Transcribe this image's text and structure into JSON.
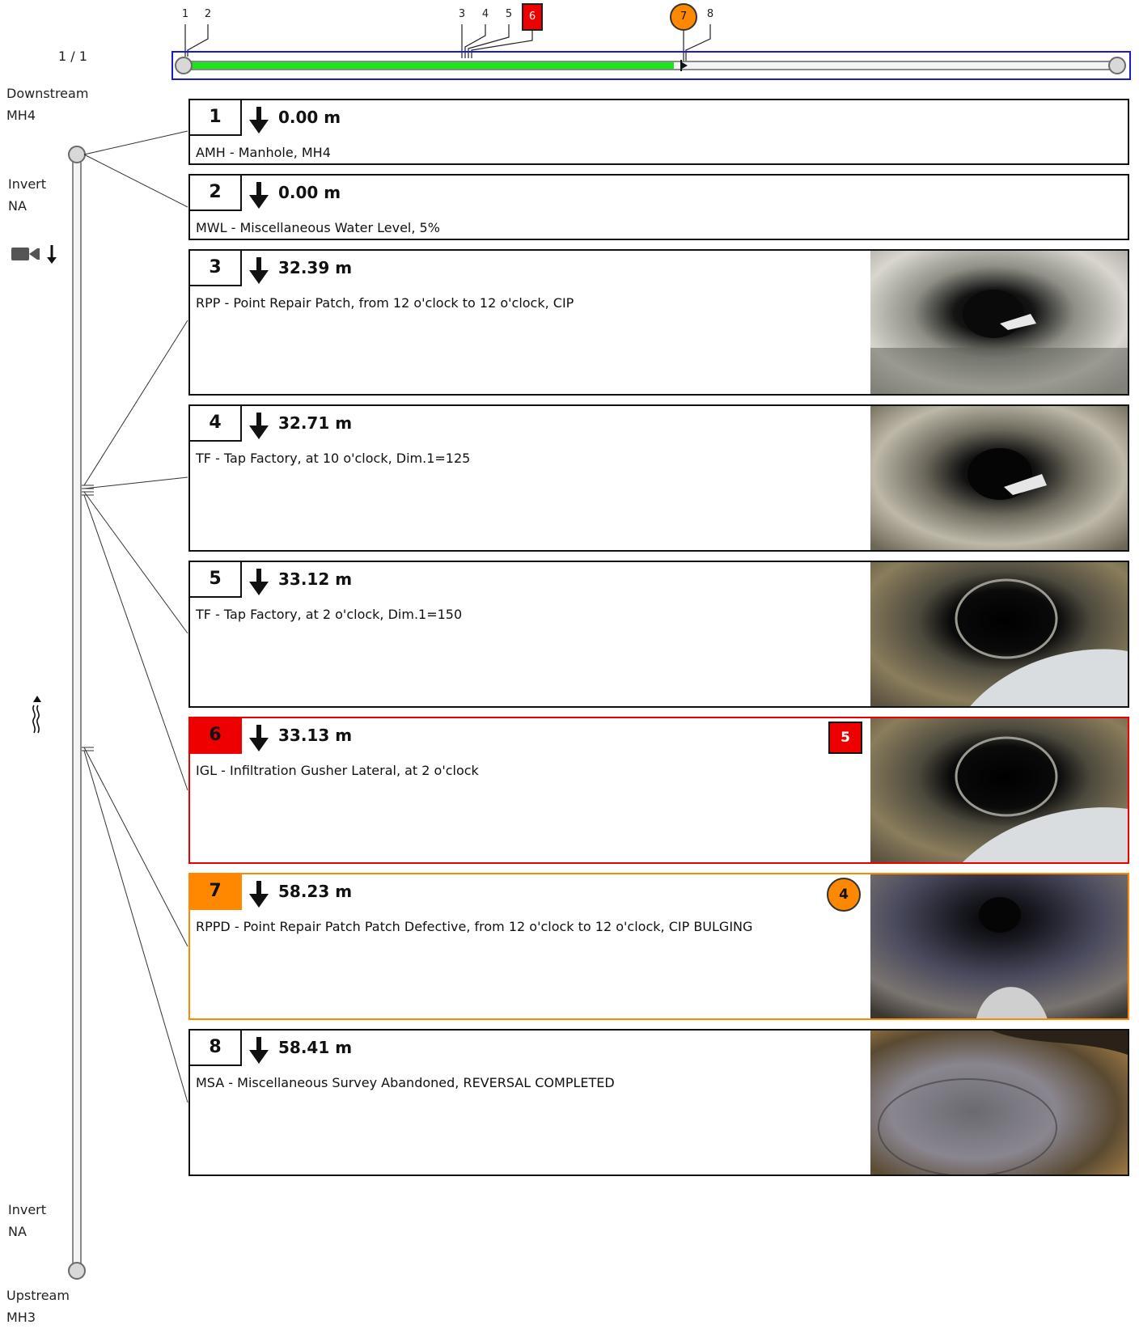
{
  "page_counter": "1 / 1",
  "downstream": {
    "title": "Downstream",
    "manhole": "MH4"
  },
  "invert_top": {
    "label": "Invert",
    "value": "NA"
  },
  "upstream": {
    "title": "Upstream",
    "manhole": "MH3"
  },
  "invert_bottom": {
    "label": "Invert",
    "value": "NA"
  },
  "icons": {
    "camera": "camera-icon",
    "direction": "down-arrow-icon",
    "flow": "flow-icon"
  },
  "colors": {
    "progress": "#19e619",
    "frame": "#1a1acc",
    "grade_red": "#ee0000",
    "grade_orange": "#ff8800"
  },
  "overview": {
    "progress_fraction": 0.5,
    "ticks": [
      "1",
      "2",
      "3",
      "4",
      "5",
      "6",
      "7",
      "8"
    ]
  },
  "events": [
    {
      "num": "1",
      "distance": "0.00 m",
      "description": "AMH - Manhole, MH4",
      "grade": ""
    },
    {
      "num": "2",
      "distance": "0.00 m",
      "description": "MWL - Miscellaneous Water Level, 5%",
      "grade": ""
    },
    {
      "num": "3",
      "distance": "32.39 m",
      "description": "RPP - Point Repair Patch, from 12 o'clock to 12 o'clock, CIP",
      "grade": ""
    },
    {
      "num": "4",
      "distance": "32.71 m",
      "description": "TF - Tap Factory, at 10 o'clock, Dim.1=125",
      "grade": ""
    },
    {
      "num": "5",
      "distance": "33.12 m",
      "description": "TF - Tap Factory, at 2 o'clock, Dim.1=150",
      "grade": ""
    },
    {
      "num": "6",
      "distance": "33.13 m",
      "description": "IGL - Infiltration Gusher Lateral, at 2 o'clock",
      "grade": "5"
    },
    {
      "num": "7",
      "distance": "58.23 m",
      "description": "RPPD - Point Repair Patch Patch Defective, from 12 o'clock to 12 o'clock, CIP BULGING",
      "grade": "4"
    },
    {
      "num": "8",
      "distance": "58.41 m",
      "description": "MSA - Miscellaneous Survey Abandoned, REVERSAL COMPLETED",
      "grade": ""
    }
  ]
}
